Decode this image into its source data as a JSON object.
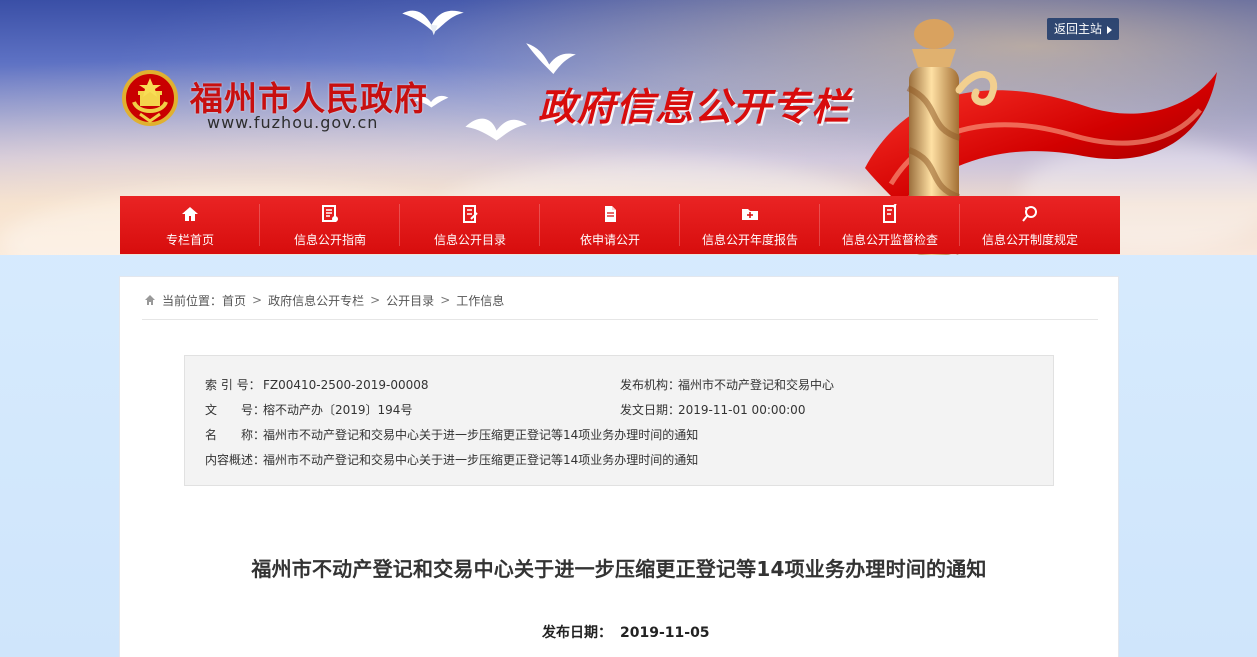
{
  "header": {
    "site_name": "福州市人民政府",
    "site_url": "www.fuzhou.gov.cn",
    "column_title": "政府信息公开专栏",
    "return_link": "返回主站"
  },
  "navigation": [
    {
      "label": "专栏首页",
      "icon": "home-icon"
    },
    {
      "label": "信息公开指南",
      "icon": "guide-icon"
    },
    {
      "label": "信息公开目录",
      "icon": "catalog-icon"
    },
    {
      "label": "依申请公开",
      "icon": "document-icon"
    },
    {
      "label": "信息公开年度报告",
      "icon": "folder-icon"
    },
    {
      "label": "信息公开监督检查",
      "icon": "inspection-icon"
    },
    {
      "label": "信息公开制度规定",
      "icon": "search-icon"
    }
  ],
  "breadcrumb": {
    "prefix": "当前位置：",
    "items": [
      "首页",
      "政府信息公开专栏",
      "公开目录",
      "工作信息"
    ],
    "separator": ">"
  },
  "metadata": {
    "index_number": {
      "label": "索 引 号：",
      "value": "FZ00410-2500-2019-00008"
    },
    "publisher": {
      "label": "发布机构：",
      "value": "福州市不动产登记和交易中心"
    },
    "document_number": {
      "label": "文　　号：",
      "value": "榕不动产办〔2019〕194号"
    },
    "document_date": {
      "label": "发文日期：",
      "value": "2019-11-01 00:00:00"
    },
    "name": {
      "label": "名　　称：",
      "value": "福州市不动产登记和交易中心关于进一步压缩更正登记等14项业务办理时间的通知"
    },
    "summary": {
      "label": "内容概述：",
      "value": "福州市不动产登记和交易中心关于进一步压缩更正登记等14项业务办理时间的通知"
    }
  },
  "article": {
    "title": "福州市不动产登记和交易中心关于进一步压缩更正登记等14项业务办理时间的通知",
    "publish_date_label": "发布日期：",
    "publish_date": "2019-11-05"
  },
  "colors": {
    "nav_red": "#d70d0d",
    "title_red": "#c80f0f",
    "page_blue": "#d7e9fb"
  }
}
